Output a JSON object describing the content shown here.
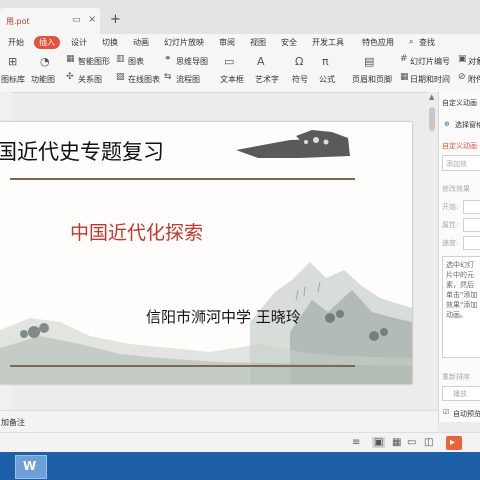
{
  "doc_tab": {
    "title": "用.pot"
  },
  "menubar": {
    "items": [
      "开始",
      "插入",
      "设计",
      "切换",
      "动画",
      "幻灯片放映",
      "审阅",
      "视图",
      "安全",
      "开发工具",
      "特色应用"
    ],
    "search": "查找"
  },
  "toolbar": {
    "row1": [
      "智能图形",
      "图表",
      "思维导图",
      "幻灯片编号",
      "对象"
    ],
    "row2": [
      "图标库",
      "功能图",
      "关系图",
      "在线图表",
      "流程图",
      "文本框",
      "艺术字",
      "符号",
      "公式",
      "页眉和页脚",
      "日期和时间",
      "附件"
    ]
  },
  "slide": {
    "title": "国近代史专题复习",
    "subtitle": "中国近代化探索",
    "author": "信阳市浉河中学    王晓玲"
  },
  "right_panel": {
    "header": "自定义动画",
    "select_pane": "选择窗格",
    "section": "自定义动画",
    "add_effect": "添加效",
    "modify_effect": "修改效果",
    "start_label": "开始:",
    "property_label": "属性:",
    "speed_label": "速度:",
    "hint": "选中幻灯片中的元素，然后单击\"添加效果\"添加动画。",
    "reorder": "重新排序",
    "play": "播放",
    "autopreview": "自动预览"
  },
  "notes": {
    "placeholder": "加备注"
  },
  "colors": {
    "accent": "#e2553b",
    "taskbar": "#1d5fa8",
    "subtitle_red": "#c0392b"
  }
}
